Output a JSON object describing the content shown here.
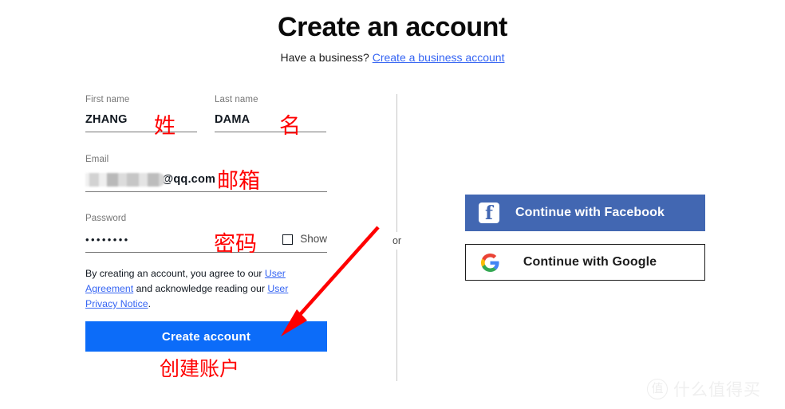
{
  "header": {
    "title": "Create an account",
    "subtitle_prefix": "Have a business?",
    "subtitle_link": "Create a business account"
  },
  "form": {
    "first_name": {
      "label": "First name",
      "value": "ZHANG"
    },
    "last_name": {
      "label": "Last name",
      "value": "DAMA"
    },
    "email": {
      "label": "Email",
      "redacted": true,
      "visible_value": "@qq.com"
    },
    "password": {
      "label": "Password",
      "value": "••••••••",
      "show_label": "Show",
      "show_checked": false
    },
    "terms": {
      "part1": "By creating an account, you agree to our ",
      "link1": "User Agreement",
      "part2": " and acknowledge reading our ",
      "link2": "User Privacy Notice",
      "part3": "."
    },
    "submit_label": "Create account"
  },
  "divider": {
    "or_label": "or"
  },
  "social": {
    "facebook": {
      "label": "Continue with Facebook",
      "icon": "facebook-icon",
      "bg": "#4267b2"
    },
    "google": {
      "label": "Continue with Google",
      "icon": "google-icon",
      "bg": "#ffffff"
    }
  },
  "annotations": {
    "color": "#ff0000",
    "first_name": "姓",
    "last_name": "名",
    "email": "邮箱",
    "password": "密码",
    "create_account": "创建账户"
  },
  "watermark": {
    "badge": "值",
    "text": "什么值得买"
  },
  "colors": {
    "link_blue": "#3665f3",
    "primary_button": "#0c6cf9",
    "facebook_blue": "#4267b2",
    "annotation_red": "#ff0000"
  }
}
